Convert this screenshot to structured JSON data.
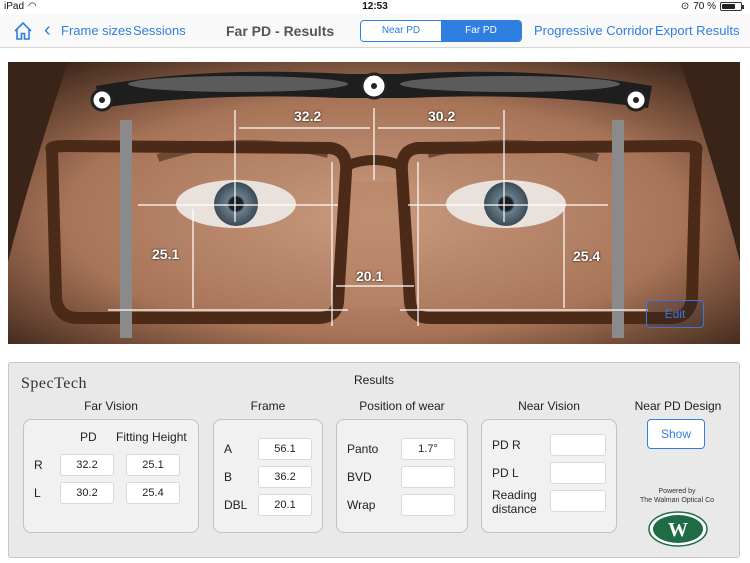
{
  "status": {
    "device": "iPad",
    "time": "12:53",
    "battery": "70 %",
    "battery_level": 0.7
  },
  "nav": {
    "back_label": "Frame sizes",
    "sessions_label": "Sessions",
    "title": "Far PD - Results",
    "segments": [
      "Near PD",
      "Far PD"
    ],
    "active_segment": "Far PD",
    "progressive_label": "Progressive Corridor",
    "export_label": "Export Results"
  },
  "photo": {
    "measurements": {
      "right_pd": "32.2",
      "left_pd": "30.2",
      "right_height": "25.1",
      "left_height": "25.4",
      "dbl": "20.1"
    },
    "edit_label": "Edit"
  },
  "results": {
    "brand": "SpecTech",
    "title": "Results",
    "far_vision": {
      "title": "Far Vision",
      "col_pd": "PD",
      "col_height": "Fitting Height",
      "rows": [
        {
          "label": "R",
          "pd": "32.2",
          "height": "25.1"
        },
        {
          "label": "L",
          "pd": "30.2",
          "height": "25.4"
        }
      ]
    },
    "frame": {
      "title": "Frame",
      "rows": [
        {
          "label": "A",
          "value": "56.1"
        },
        {
          "label": "B",
          "value": "36.2"
        },
        {
          "label": "DBL",
          "value": "20.1"
        }
      ]
    },
    "position_of_wear": {
      "title": "Position of wear",
      "rows": [
        {
          "label": "Panto",
          "value": "1.7°"
        },
        {
          "label": "BVD",
          "value": ""
        },
        {
          "label": "Wrap",
          "value": ""
        }
      ]
    },
    "near_vision": {
      "title": "Near Vision",
      "rows": [
        {
          "label": "PD R",
          "value": ""
        },
        {
          "label": "PD L",
          "value": ""
        },
        {
          "label": "Reading distance",
          "value": ""
        }
      ]
    },
    "near_pd_design": {
      "title": "Near PD Design",
      "show_label": "Show"
    },
    "powered_by": "Powered by",
    "company": "The Walman Optical Co",
    "logo_letter": "W"
  },
  "colors": {
    "accent": "#2f7fe0",
    "logo_green": "#1f6b45"
  }
}
